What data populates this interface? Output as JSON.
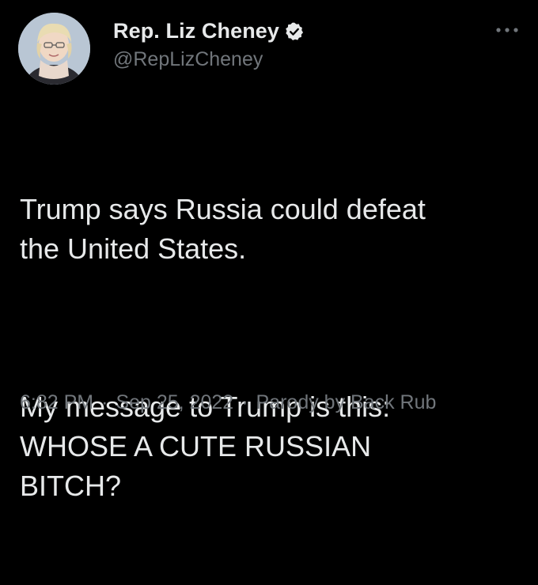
{
  "tweet": {
    "display_name": "Rep. Liz Cheney",
    "handle": "@RepLizCheney",
    "verified": true,
    "text_lines": [
      "Trump says Russia could defeat\nthe United States.",
      "My message to Trump is this:\nWHOSE A CUTE RUSSIAN\nBITCH?"
    ],
    "time": "6:82 PM",
    "date": "Sep 25, 2022",
    "source": "Parody by Back Rub"
  },
  "icons": {
    "verified": "verified-badge-icon",
    "more": "more-options-icon"
  },
  "colors": {
    "background": "#000000",
    "primary_text": "#e7e9ea",
    "secondary_text": "#71767b"
  }
}
